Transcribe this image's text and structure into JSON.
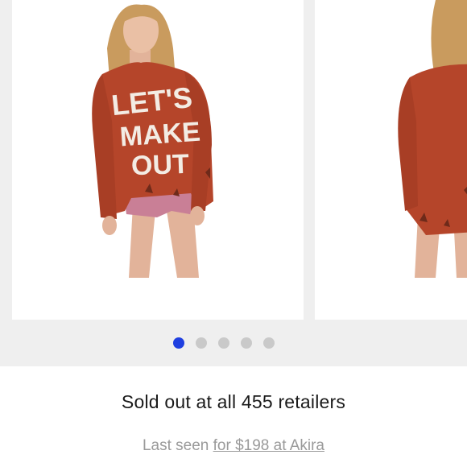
{
  "carousel": {
    "slides": [
      {
        "alt": "front view",
        "sweater_text": [
          "LET'S",
          "MAKE",
          "OUT"
        ]
      },
      {
        "alt": "back view"
      }
    ],
    "dots": [
      true,
      false,
      false,
      false,
      false
    ],
    "colors": {
      "active_dot": "#1f3fe0",
      "inactive_dot": "#c9c9c9",
      "sweater": "#b5452a"
    }
  },
  "status": {
    "title": "Sold out at all 455 retailers",
    "last_seen_prefix": "Last seen ",
    "last_seen_link": "for $198 at Akira"
  }
}
